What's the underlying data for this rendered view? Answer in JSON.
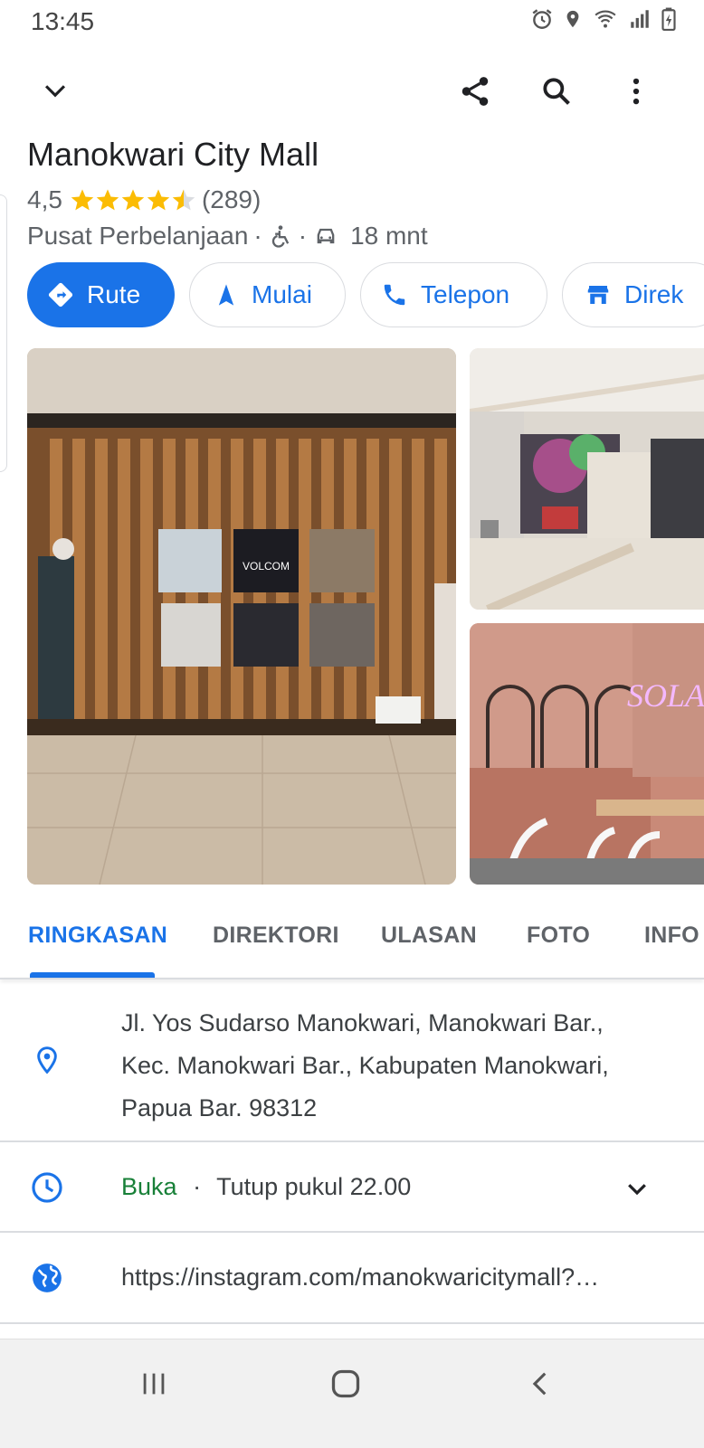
{
  "status_bar": {
    "time": "13:45"
  },
  "place": {
    "name": "Manokwari City Mall",
    "rating": "4,5",
    "rating_value": 4.5,
    "review_count": "(289)",
    "category": "Pusat Perbelanjaan",
    "separator": "·",
    "drive_time": "18 mnt"
  },
  "actions": [
    {
      "label": "Rute",
      "icon": "directions-icon",
      "style": "primary"
    },
    {
      "label": "Mulai",
      "icon": "navigation-icon",
      "style": "outline"
    },
    {
      "label": "Telepon",
      "icon": "phone-icon",
      "style": "outline"
    },
    {
      "label": "Direk",
      "icon": "store-icon",
      "style": "outline"
    }
  ],
  "tabs": [
    {
      "label": "RINGKASAN",
      "active": true
    },
    {
      "label": "DIREKTORI",
      "active": false
    },
    {
      "label": "ULASAN",
      "active": false
    },
    {
      "label": "FOTO",
      "active": false
    },
    {
      "label": "INFO",
      "active": false
    }
  ],
  "address": {
    "line1": "Jl. Yos Sudarso Manokwari, Manokwari Bar.,",
    "line2": "Kec. Manokwari Bar., Kabupaten Manokwari,",
    "line3": "Papua Bar. 98312"
  },
  "hours": {
    "status": "Buka",
    "separator": "·",
    "closing": "Tutup pukul 22.00"
  },
  "website": "https://instagram.com/manokwaricitymall?…",
  "photo_sign_text": "SOLARI",
  "photo_poster_text": "VOLCOM",
  "colors": {
    "accent": "#1a73e8",
    "open": "#188038",
    "star": "#fbbc04",
    "text_secondary": "#5f6368"
  }
}
